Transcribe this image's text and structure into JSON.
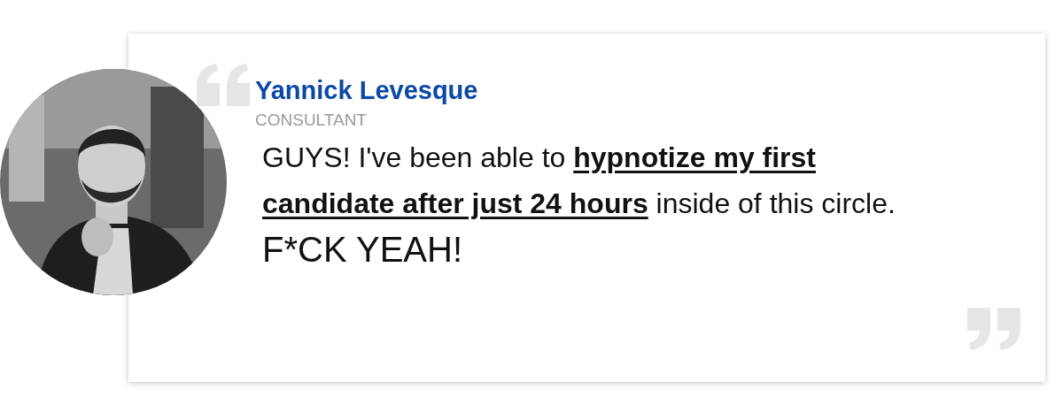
{
  "testimonial": {
    "name": "Yannick Levesque",
    "role": "CONSULTANT",
    "quote": [
      {
        "kind": "plain",
        "text": "GUYS! I've been able to "
      },
      {
        "kind": "emphasis",
        "text": "hypnotize my first candidate after just 24 hours"
      },
      {
        "kind": "plain",
        "text": " inside of this circle. "
      },
      {
        "kind": "large",
        "text": "F*CK YEAH!"
      }
    ]
  }
}
